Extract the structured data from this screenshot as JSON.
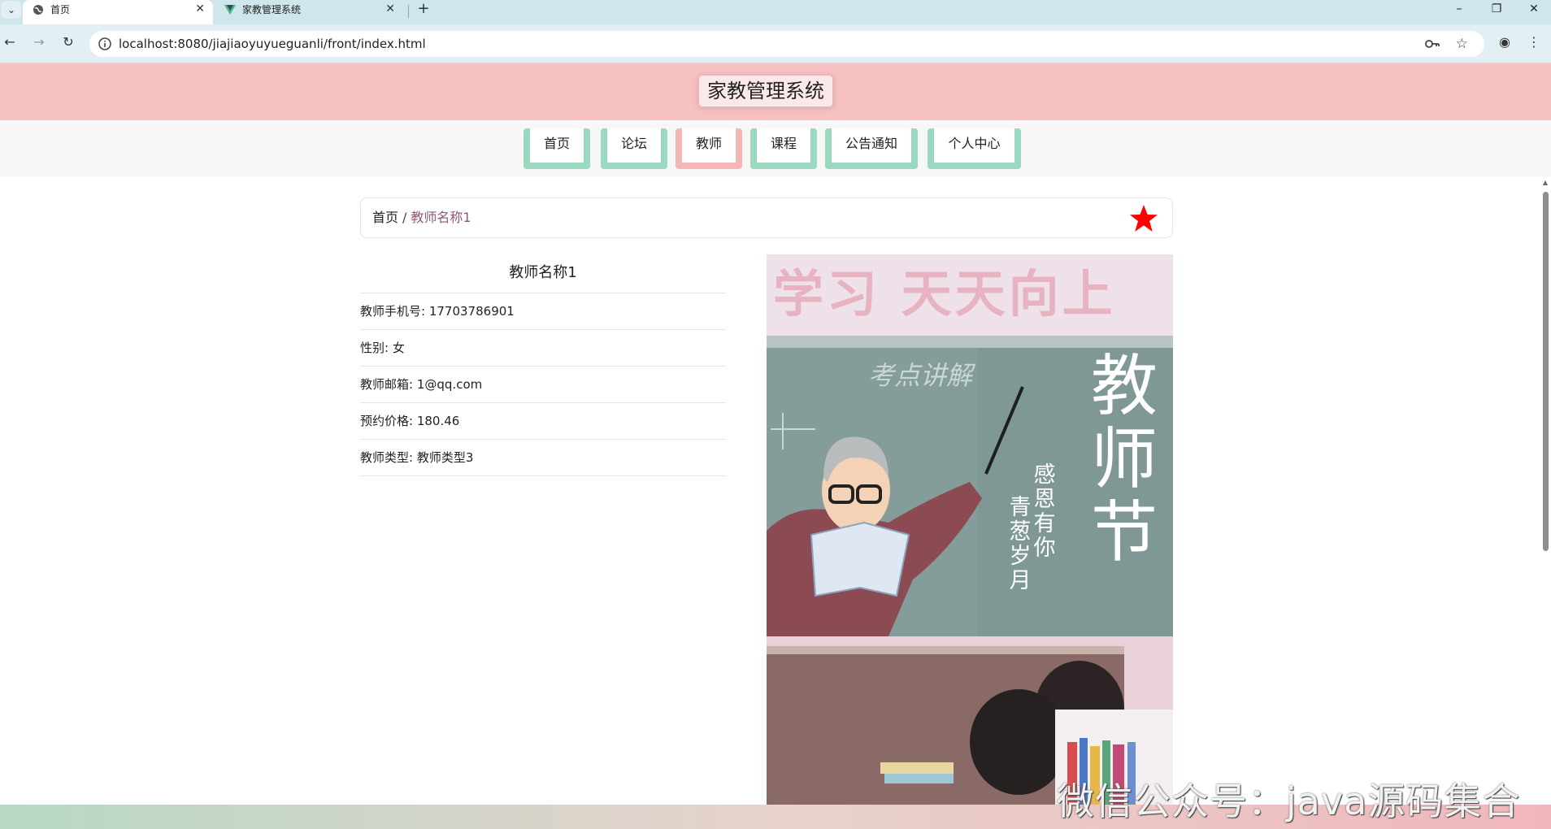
{
  "browser": {
    "tabs": [
      {
        "title": "首页",
        "active": true
      },
      {
        "title": "家教管理系统",
        "active": false
      }
    ],
    "url": "localhost:8080/jiajiaoyuyueguanli/front/index.html"
  },
  "header": {
    "title": "家教管理系统"
  },
  "nav": {
    "items": [
      {
        "label": "首页",
        "active": false
      },
      {
        "label": "论坛",
        "active": false
      },
      {
        "label": "教师",
        "active": true
      },
      {
        "label": "课程",
        "active": false
      },
      {
        "label": "公告通知",
        "active": false
      },
      {
        "label": "个人中心",
        "active": false
      }
    ]
  },
  "breadcrumb": {
    "home": "首页",
    "separator": "/",
    "current": "教师名称1"
  },
  "teacher": {
    "name": "教师名称1",
    "fields": [
      {
        "label": "教师手机号",
        "value": "17703786901"
      },
      {
        "label": "性别",
        "value": "女"
      },
      {
        "label": "教师邮箱",
        "value": "1@qq.com"
      },
      {
        "label": "预约价格",
        "value": "180.46"
      },
      {
        "label": "教师类型",
        "value": "教师类型3"
      }
    ]
  },
  "poster": {
    "banner_text": "学习 天天向上",
    "title": "教师节",
    "line1": "感恩有你",
    "line2": "青葱岁月",
    "board_text": "考点讲解"
  },
  "watermark": "微信公众号：java源码集合",
  "colors": {
    "header_bg": "#f7c1c2",
    "nav_accent": "#9ad8c0",
    "nav_active": "#f4b6b7",
    "favorite_star": "#ff0000"
  }
}
